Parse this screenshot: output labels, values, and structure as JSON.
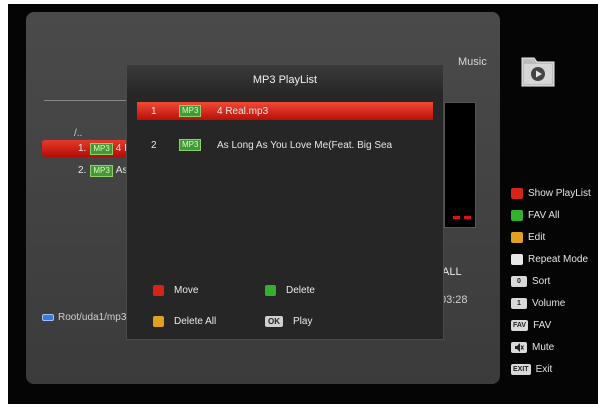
{
  "background": {
    "header_label": "Music",
    "folder_icon": "folder-play-icon",
    "path_up": "/..",
    "files": [
      {
        "index": "1.",
        "badge": "MP3",
        "name": "4 I"
      },
      {
        "index": "2.",
        "badge": "MP3",
        "name": "As"
      }
    ],
    "repeat_value": "ALL",
    "time": "03:28",
    "path": "Root/uda1/mp3"
  },
  "popup": {
    "title": "MP3 PlayList",
    "items": [
      {
        "num": "1",
        "badge": "MP3",
        "name": "4 Real.mp3"
      },
      {
        "num": "2",
        "badge": "MP3",
        "name": "As Long As You Love Me(Feat. Big Sea"
      }
    ],
    "buttons": {
      "move": "Move",
      "delete": "Delete",
      "delete_all": "Delete All",
      "ok_key": "OK",
      "play": "Play"
    }
  },
  "legend": [
    {
      "key": "",
      "label": "Show PlayList"
    },
    {
      "key": "",
      "label": "FAV All"
    },
    {
      "key": "",
      "label": "Edit"
    },
    {
      "key": "",
      "label": "Repeat Mode"
    },
    {
      "key": "0",
      "label": "Sort"
    },
    {
      "key": "1",
      "label": "Volume"
    },
    {
      "key": "FAV",
      "label": "FAV"
    },
    {
      "key": "",
      "label": "Mute"
    },
    {
      "key": "EXIT",
      "label": "Exit"
    }
  ],
  "colors": {
    "red": "#d62418",
    "green": "#34b030",
    "yellow": "#e0a020",
    "white": "#e8e8e8",
    "highlight": "#c01a10"
  }
}
